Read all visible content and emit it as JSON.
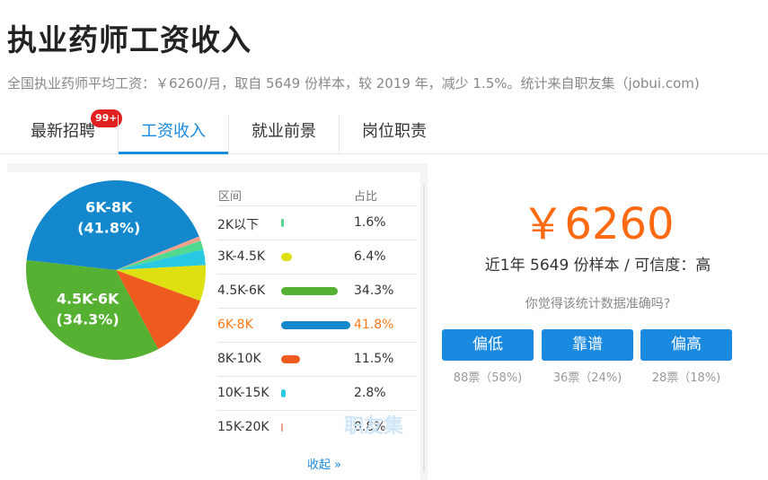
{
  "header": {
    "title": "执业药师工资收入",
    "subtitle": "全国执业药师平均工资：￥6260/月，取自 5649 份样本，较 2019 年，减少 1.5%。统计来自职友集（jobui.com)"
  },
  "tabs": [
    {
      "label": "最新招聘",
      "badge": "99+"
    },
    {
      "label": "工资收入",
      "active": true
    },
    {
      "label": "就业前景"
    },
    {
      "label": "岗位职责"
    }
  ],
  "table": {
    "col_range": "区间",
    "col_pct": "占比",
    "collapse": "收起 »",
    "watermark": "职友集"
  },
  "chart_data": {
    "type": "pie",
    "categories": [
      "2K以下",
      "3K-4.5K",
      "4.5K-6K",
      "6K-8K",
      "8K-10K",
      "10K-15K",
      "15K-20K"
    ],
    "values": [
      1.6,
      6.4,
      34.3,
      41.8,
      11.5,
      2.8,
      0.8
    ],
    "percent_labels": [
      "1.6%",
      "6.4%",
      "34.3%",
      "41.8%",
      "11.5%",
      "2.8%",
      "0.8%"
    ],
    "colors": [
      "#50d98f",
      "#dfe012",
      "#56b133",
      "#1488cc",
      "#ef5a1f",
      "#29c9e3",
      "#f0a08a"
    ],
    "highlight": "6K-8K",
    "pie_labels": [
      {
        "category": "6K-8K",
        "range": "6K-8K",
        "pct": "(41.8%)"
      },
      {
        "category": "4.5K-6K",
        "range": "4.5K-6K",
        "pct": "(34.3%)"
      }
    ]
  },
  "summary": {
    "salary": "￥6260",
    "samples": "近1年 5649 份样本 / 可信度：高",
    "question": "你觉得该统计数据准确吗?"
  },
  "votes": [
    {
      "label": "偏低",
      "count": "88票（58%)"
    },
    {
      "label": "靠谱",
      "count": "36票（24%)"
    },
    {
      "label": "偏高",
      "count": "28票（18%)"
    }
  ],
  "colors": {
    "accent": "#1a8ae0",
    "salary": "#ff6a13",
    "badge": "#e02020"
  }
}
